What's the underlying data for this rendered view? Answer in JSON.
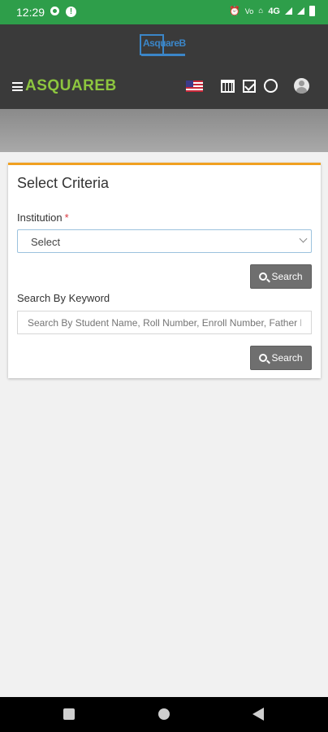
{
  "status_bar": {
    "time": "12:29",
    "network": "4G",
    "icons": [
      "gear-icon",
      "alert-icon",
      "alarm-icon",
      "volte-icon",
      "wifi-call-icon",
      "signal-icon",
      "signal-icon",
      "battery-icon"
    ]
  },
  "header": {
    "logo_text": "AsquareB",
    "brand": "ASQUAREB",
    "icons": [
      "hamburger-menu-icon",
      "us-flag-icon",
      "calendar-icon",
      "checkbox-icon",
      "whatsapp-icon",
      "user-avatar-icon"
    ],
    "colors": {
      "header_bg": "#3a3a3a",
      "brand": "#8dc63f",
      "logo": "#3b86c8",
      "status_bar": "#2e9e4a"
    }
  },
  "criteria": {
    "title": "Select Criteria",
    "institution_label": "Institution",
    "required_mark": "*",
    "institution_value": "Select",
    "search_button": "Search",
    "keyword_label": "Search By Keyword",
    "keyword_placeholder": "Search By Student Name, Roll Number, Enroll Number, Father Name",
    "keyword_search_button": "Search",
    "colors": {
      "accent_border": "#f0a020",
      "button_bg": "#6f6f6f",
      "required": "#d9363e"
    }
  },
  "nav_bar": {
    "icons": [
      "recents-icon",
      "home-icon",
      "back-icon"
    ]
  }
}
